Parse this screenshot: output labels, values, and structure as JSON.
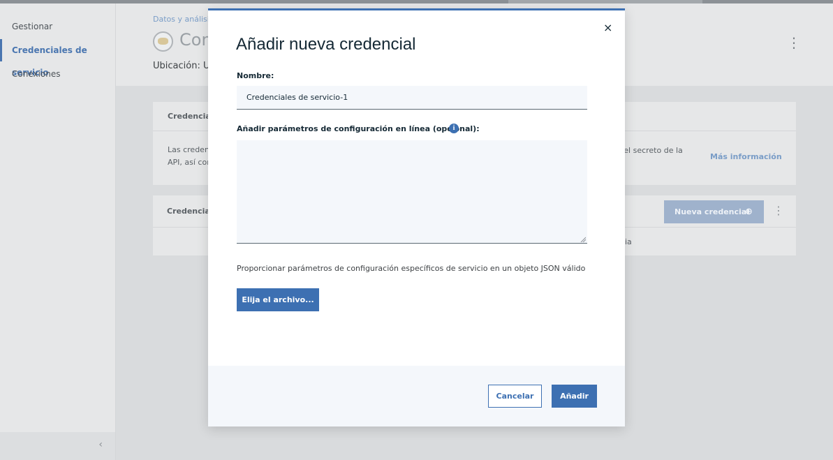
{
  "sidebar": {
    "items": [
      {
        "label": "Gestionar"
      },
      {
        "label": "Credenciales de servicio"
      },
      {
        "label": "Conexiones"
      }
    ],
    "collapse_icon": "chevron-left-icon"
  },
  "page": {
    "breadcrumb": "Datos y análisis",
    "title_partial": "Com",
    "location_partial": "Ubicación: Ur",
    "card1": {
      "header_partial": "Credencial",
      "body_line1_partial": "Las credenc",
      "body_line2_partial": "API, así cor",
      "body_right_partial": "e y el secreto de la",
      "more_link": "Más información"
    },
    "card2": {
      "header_partial": "Credencial",
      "new_credential_label": "Nueva credencial",
      "row_partial": "ia"
    }
  },
  "modal": {
    "close_label": "×",
    "title": "Añadir nueva credencial",
    "name_label": "Nombre:",
    "name_value": "Credenciales de servicio-1",
    "params_label": "Añadir parámetros de configuración en línea (opcional):",
    "info_icon": "info-icon",
    "params_value": "",
    "helper_text": "Proporcionar parámetros de configuración específicos de servicio en un objeto JSON válido",
    "choose_file_label": "Elija el archivo...",
    "cancel_label": "Cancelar",
    "add_label": "Añadir"
  },
  "colors": {
    "accent": "#3d70b2",
    "link": "#4a76b0"
  }
}
